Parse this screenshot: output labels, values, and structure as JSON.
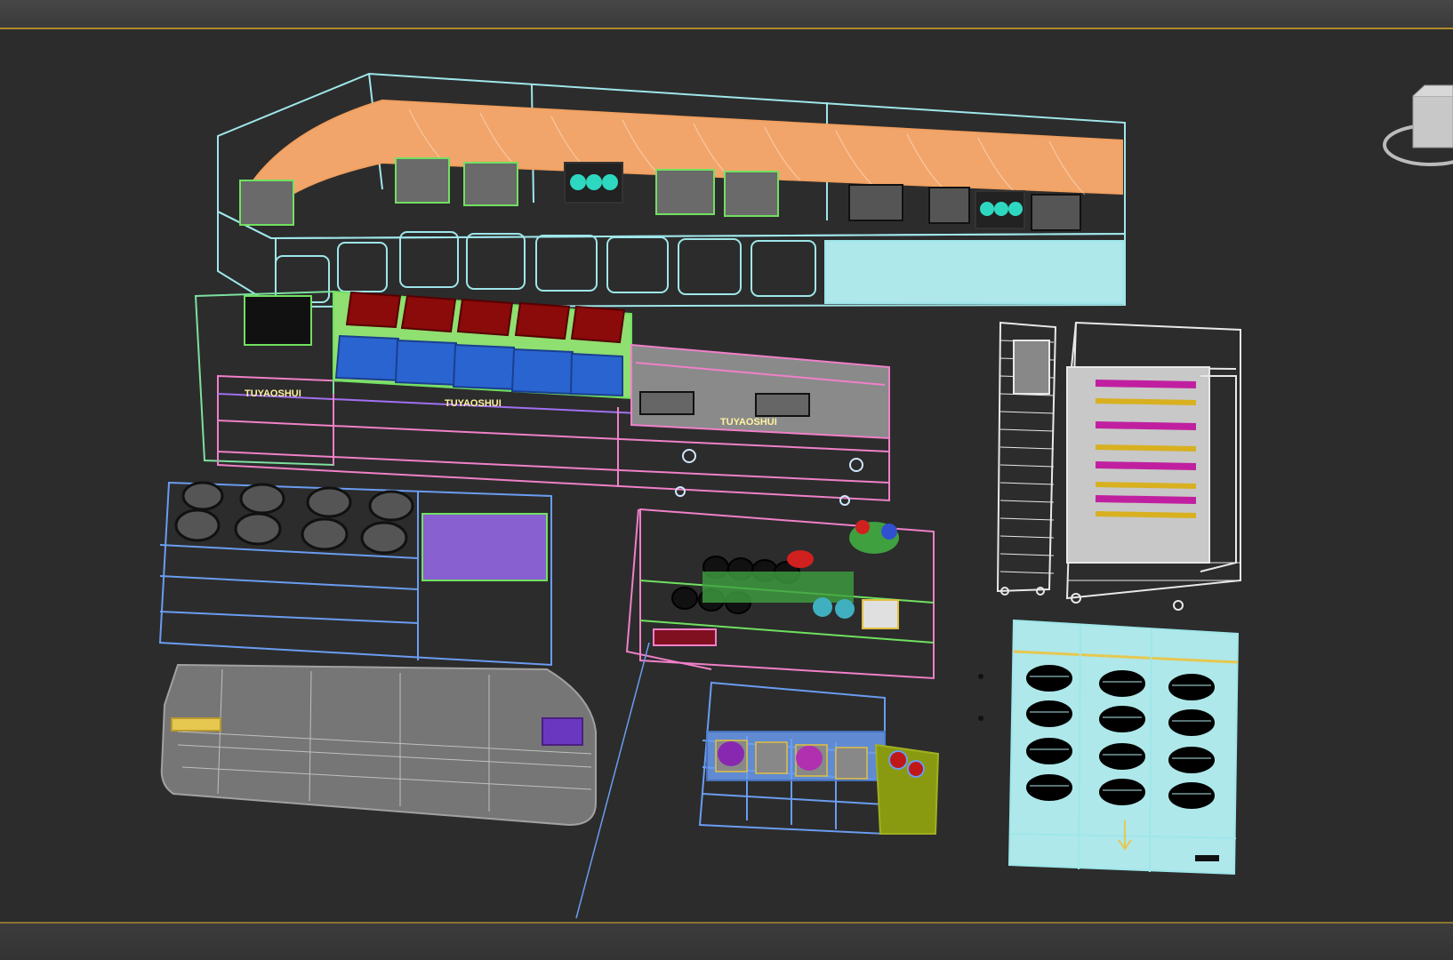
{
  "app": {
    "viewport_labels": {
      "counter_left": "TUYAOSHUI",
      "counter_mid": "TUYAOSHUI",
      "counter_right": "TUYAOSHUI"
    }
  },
  "colors": {
    "background": "#2c2c2c",
    "accent_border": "#b08a2a",
    "orange_wire": "#f0a060",
    "cyan_wire": "#9fe6ea",
    "pink_wire": "#f080c8",
    "blue_wire": "#6a9cf0",
    "green_wire": "#70e060",
    "gray_wire": "#a8a8a8",
    "white_wire": "#e8e8e8"
  },
  "icons": {
    "navcube": "viewcube-icon"
  }
}
